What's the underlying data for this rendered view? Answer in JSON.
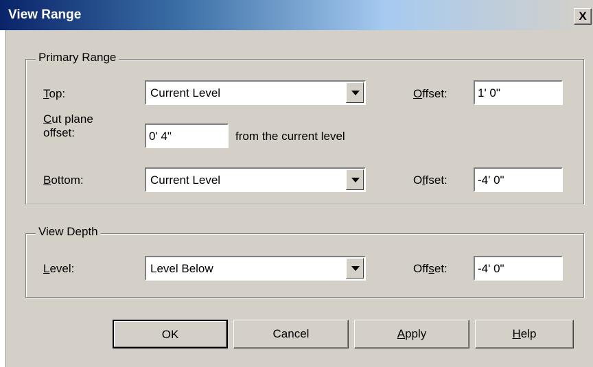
{
  "window": {
    "title": "View Range",
    "close_label": "X"
  },
  "primary_range": {
    "legend": "Primary Range",
    "top": {
      "label_prefix": "",
      "label_accel": "T",
      "label_rest": "op:",
      "value": "Current Level",
      "offset_label_accel": "O",
      "offset_label_rest": "ffset:",
      "offset_value": "1'  0\""
    },
    "cut_plane": {
      "label_line1_accel": "C",
      "label_line1_rest": "ut plane",
      "label_line2": "offset:",
      "value": "0'  4\"",
      "suffix": "from the current level"
    },
    "bottom": {
      "label_accel": "B",
      "label_rest": "ottom:",
      "value": "Current Level",
      "offset_label_prefix": "O",
      "offset_label_accel": "f",
      "offset_label_rest": "fset:",
      "offset_value": "-4'  0\""
    }
  },
  "view_depth": {
    "legend": "View Depth",
    "level": {
      "label_accel": "L",
      "label_rest": "evel:",
      "value": "Level Below",
      "offset_label_prefix": "Off",
      "offset_label_accel": "s",
      "offset_label_rest": "et:",
      "offset_value": "-4'  0\""
    }
  },
  "buttons": {
    "ok": "OK",
    "cancel": "Cancel",
    "apply_accel": "A",
    "apply_rest": "pply",
    "help_accel": "H",
    "help_rest": "elp"
  }
}
